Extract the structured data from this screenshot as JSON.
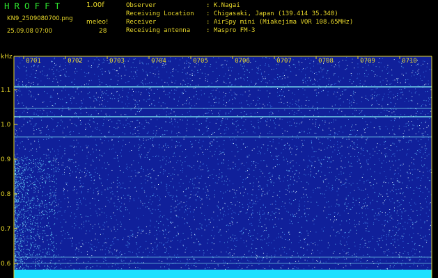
{
  "header": {
    "app_title": "HROFFT",
    "version": "1.00f",
    "file_name": "KN9_2509080700.png",
    "mode": "meleo!",
    "count": "28",
    "timestamp": "25.09.08 07:00",
    "info": [
      {
        "key": "Observer",
        "value": ": K.Nagai"
      },
      {
        "key": "Receiving Location",
        "value": ": Chigasaki, Japan (139.414 35.340)"
      },
      {
        "key": "Receiver",
        "value": ": AirSpy mini (Miakejima VOR 108.65MHz)"
      },
      {
        "key": "Receiving antenna",
        "value": ": Maspro FM-3"
      }
    ]
  },
  "spectrogram": {
    "unit_label": "kHz",
    "time_labels": [
      "0701",
      "0702",
      "0703",
      "0704",
      "0705",
      "0706",
      "0707",
      "0708",
      "0709",
      "0710"
    ],
    "freq_labels": [
      "1.1",
      "1.0",
      "0.9",
      "0.8",
      "0.7",
      "0.6"
    ],
    "colors": {
      "background": "#10209a",
      "frame": "#e8d82a",
      "signal": "#80e8f0",
      "bottom_band": "#20e0ff"
    }
  }
}
